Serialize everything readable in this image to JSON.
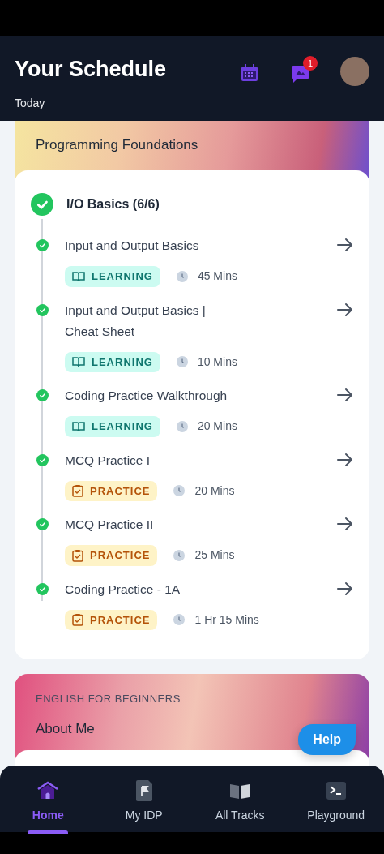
{
  "header": {
    "title": "Your Schedule",
    "subtitle": "Today",
    "notification_count": "1"
  },
  "courses": [
    {
      "title": "Programming Foundations",
      "module": {
        "title": "I/O Basics (6/6)",
        "completed": true,
        "items": [
          {
            "title": "Input and Output Basics",
            "kind": "learning",
            "tag": "LEARNING",
            "duration": "45 Mins",
            "completed": true
          },
          {
            "title": "Input and Output Basics | Cheat Sheet",
            "kind": "learning",
            "tag": "LEARNING",
            "duration": "10 Mins",
            "completed": true
          },
          {
            "title": "Coding Practice Walkthrough",
            "kind": "learning",
            "tag": "LEARNING",
            "duration": "20 Mins",
            "completed": true
          },
          {
            "title": "MCQ Practice I",
            "kind": "practice",
            "tag": "PRACTICE",
            "duration": "20 Mins",
            "completed": true
          },
          {
            "title": "MCQ Practice II",
            "kind": "practice",
            "tag": "PRACTICE",
            "duration": "25 Mins",
            "completed": true
          },
          {
            "title": "Coding Practice - 1A",
            "kind": "practice",
            "tag": "PRACTICE",
            "duration": "1 Hr 15 Mins",
            "completed": true
          }
        ]
      }
    },
    {
      "category": "ENGLISH FOR BEGINNERS",
      "title": "About Me"
    }
  ],
  "help_button": "Help",
  "nav": [
    {
      "label": "Home",
      "selected": true
    },
    {
      "label": "My IDP",
      "selected": false
    },
    {
      "label": "All Tracks",
      "selected": false
    },
    {
      "label": "Playground",
      "selected": false
    }
  ]
}
